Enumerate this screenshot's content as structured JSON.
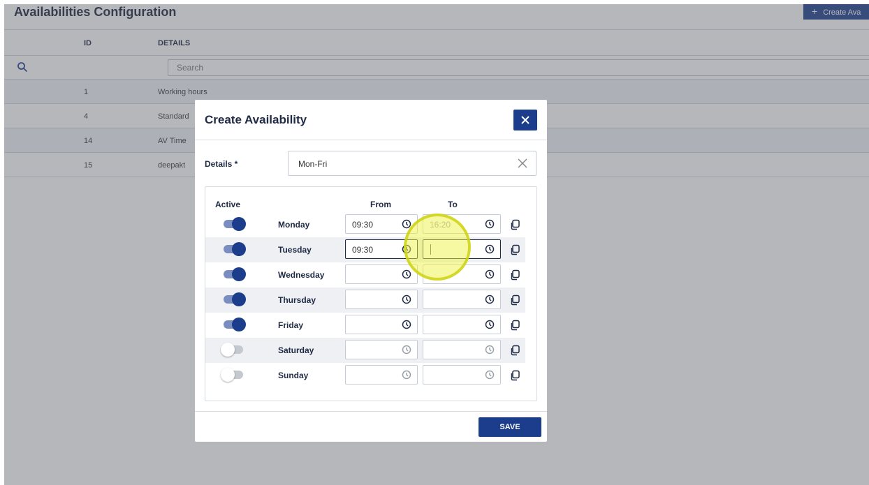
{
  "page": {
    "title": "Availabilities Configuration",
    "create_button": "Create Ava"
  },
  "table": {
    "columns": [
      "ID",
      "DETAILS"
    ],
    "search_placeholder": "Search",
    "rows": [
      {
        "id": "1",
        "details": "Working hours"
      },
      {
        "id": "4",
        "details": "Standard"
      },
      {
        "id": "14",
        "details": "AV Time"
      },
      {
        "id": "15",
        "details": "deepakt"
      }
    ]
  },
  "modal": {
    "title": "Create Availability",
    "details_label": "Details *",
    "details_value": "Mon-Fri",
    "headers": {
      "active": "Active",
      "from": "From",
      "to": "To"
    },
    "days": [
      {
        "name": "Monday",
        "active": true,
        "from": "09:30",
        "to": "16:20"
      },
      {
        "name": "Tuesday",
        "active": true,
        "from": "09:30",
        "to": ""
      },
      {
        "name": "Wednesday",
        "active": true,
        "from": "",
        "to": ""
      },
      {
        "name": "Thursday",
        "active": true,
        "from": "",
        "to": ""
      },
      {
        "name": "Friday",
        "active": true,
        "from": "",
        "to": ""
      },
      {
        "name": "Saturday",
        "active": false,
        "from": "",
        "to": ""
      },
      {
        "name": "Sunday",
        "active": false,
        "from": "",
        "to": ""
      }
    ],
    "save_label": "SAVE"
  },
  "colors": {
    "primary": "#1c3c8c",
    "toggle_track_on": "#7a8dc0",
    "highlight": "#eef246"
  }
}
